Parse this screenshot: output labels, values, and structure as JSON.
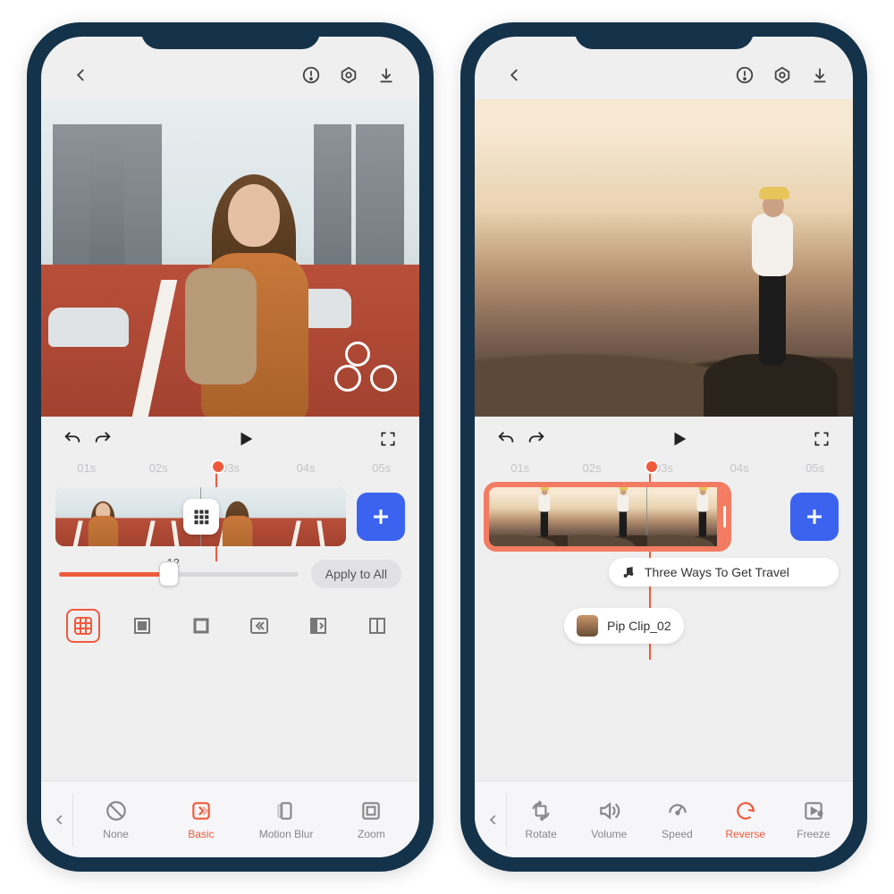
{
  "phone1": {
    "topbar": {
      "back": "‹",
      "warn": "!",
      "settings": "⚙",
      "download": "⬇"
    },
    "ruler": [
      "01s",
      "02s",
      "03s",
      "04s",
      "05s"
    ],
    "playhead_pos": "46%",
    "slider": {
      "value": "12",
      "apply": "Apply to All"
    },
    "tabs": [
      {
        "key": "none",
        "label": "None"
      },
      {
        "key": "basic",
        "label": "Basic"
      },
      {
        "key": "motion",
        "label": "Motion Blur"
      },
      {
        "key": "zoom",
        "label": "Zoom"
      }
    ],
    "active_tab": "basic"
  },
  "phone2": {
    "topbar": {
      "back": "‹",
      "warn": "!",
      "settings": "⚙",
      "download": "⬇"
    },
    "ruler": [
      "01s",
      "02s",
      "03s",
      "04s",
      "05s"
    ],
    "playhead_pos": "46%",
    "audio_clip": "Three Ways To Get Travel",
    "pip_clip": "Pip Clip_02",
    "tabs": [
      {
        "key": "rotate",
        "label": "Rotate"
      },
      {
        "key": "volume",
        "label": "Volume"
      },
      {
        "key": "speed",
        "label": "Speed"
      },
      {
        "key": "reverse",
        "label": "Reverse"
      },
      {
        "key": "freeze",
        "label": "Freeze"
      }
    ],
    "active_tab": "reverse"
  }
}
